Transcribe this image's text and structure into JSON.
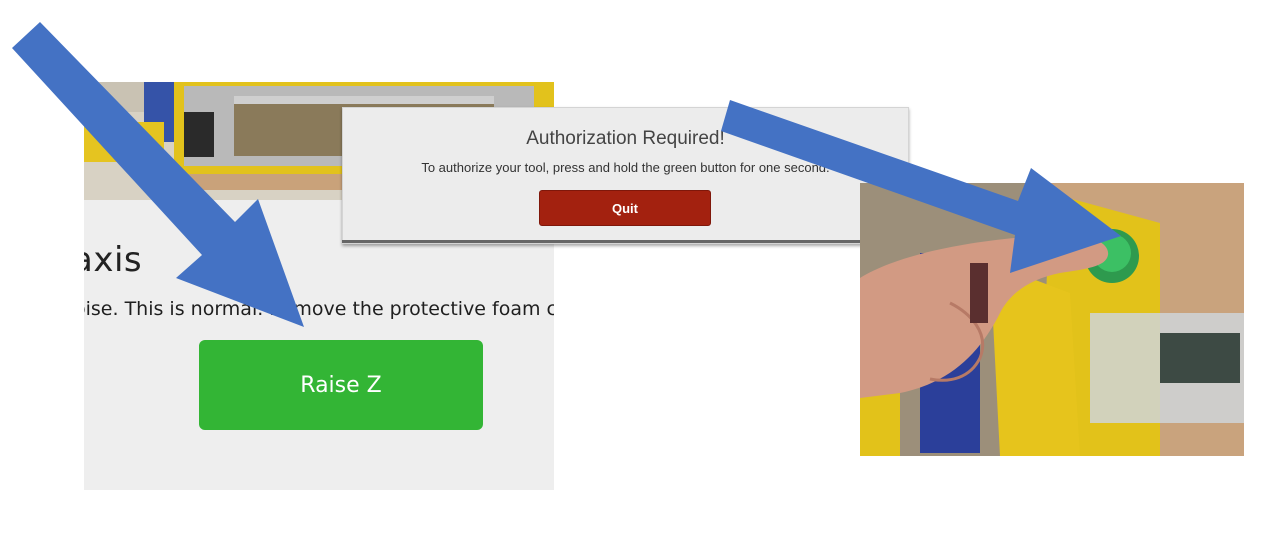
{
  "left_card": {
    "heading": "axis",
    "instruction": "oise. This is normal. Remove the protective foam circle.",
    "raise_button_label": "Raise Z"
  },
  "auth_dialog": {
    "title": "Authorization Required!",
    "message": "To authorize your tool, press and hold the green button for one second.",
    "quit_label": "Quit"
  },
  "colors": {
    "arrow": "#4472c4",
    "raise_button": "#33b535",
    "quit_button": "#a3210f",
    "card_background": "#eeeeee"
  },
  "icons": {
    "arrow_1": "arrow-to-raise-z-icon",
    "arrow_2": "arrow-to-green-button-icon"
  }
}
